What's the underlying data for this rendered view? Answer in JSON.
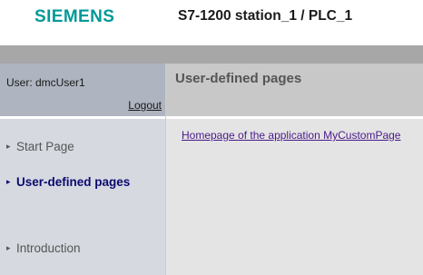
{
  "header": {
    "logo_text": "SIEMENS",
    "station_title": "S7-1200 station_1 / PLC_1"
  },
  "user_panel": {
    "user_label": "User: dmcUser1",
    "logout_label": "Logout"
  },
  "nav": {
    "items": [
      {
        "label": "Start Page",
        "active": false
      },
      {
        "label": "User-defined pages",
        "active": true
      },
      {
        "label": "Introduction",
        "active": false
      }
    ]
  },
  "main": {
    "title": "User-defined pages",
    "app_link_label": "Homepage of the application MyCustomPage"
  },
  "colors": {
    "brand": "#009999",
    "active_nav": "#0a0a6e",
    "link": "#4a1a8a"
  },
  "icons": {
    "nav_arrow": "triangle-right-icon"
  }
}
